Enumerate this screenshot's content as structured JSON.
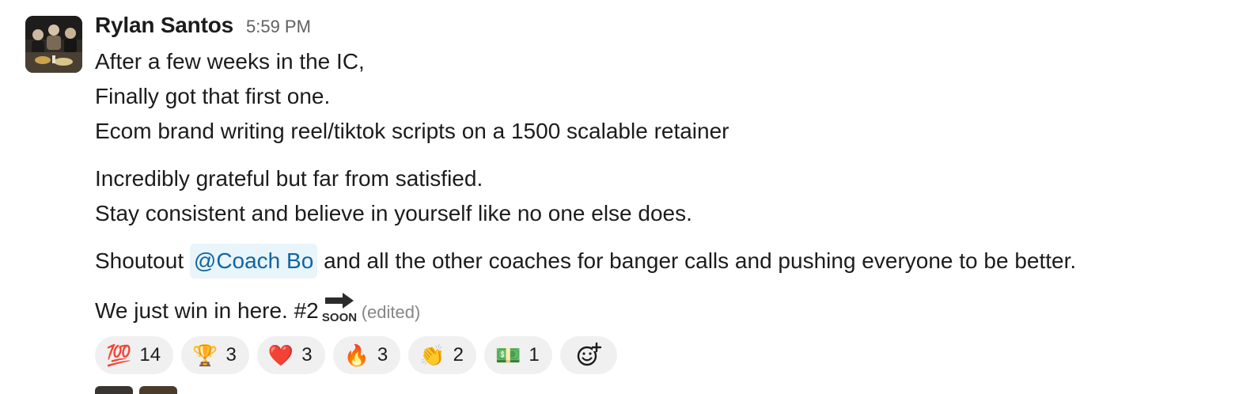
{
  "message": {
    "author": "Rylan Santos",
    "timestamp": "5:59 PM",
    "lines": [
      "After a few weeks in the IC,",
      "Finally got that first one.",
      "Ecom brand writing reel/tiktok scripts on a 1500 scalable retainer",
      "Incredibly grateful but far from satisfied.",
      "Stay consistent and believe in yourself like no one else does."
    ],
    "shoutout_prefix": "Shoutout",
    "mention": "@Coach Bo",
    "shoutout_suffix": "and all the other coaches for banger calls and pushing everyone to be better.",
    "last_line": "We just win in here. #2",
    "soon_emoji_text": "SOON",
    "edited_label": "(edited)"
  },
  "reactions": [
    {
      "icon": "hundred-points-icon",
      "emoji": "💯",
      "count": "14"
    },
    {
      "icon": "trophy-icon",
      "emoji": "🏆",
      "count": "3"
    },
    {
      "icon": "red-heart-icon",
      "emoji": "❤️",
      "count": "3"
    },
    {
      "icon": "fire-icon",
      "emoji": "🔥",
      "count": "3"
    },
    {
      "icon": "clapping-hands-icon",
      "emoji": "👏",
      "count": "2"
    },
    {
      "icon": "money-icon",
      "emoji": "💵",
      "count": "1"
    }
  ],
  "add_reaction_icon": "add-reaction-icon"
}
